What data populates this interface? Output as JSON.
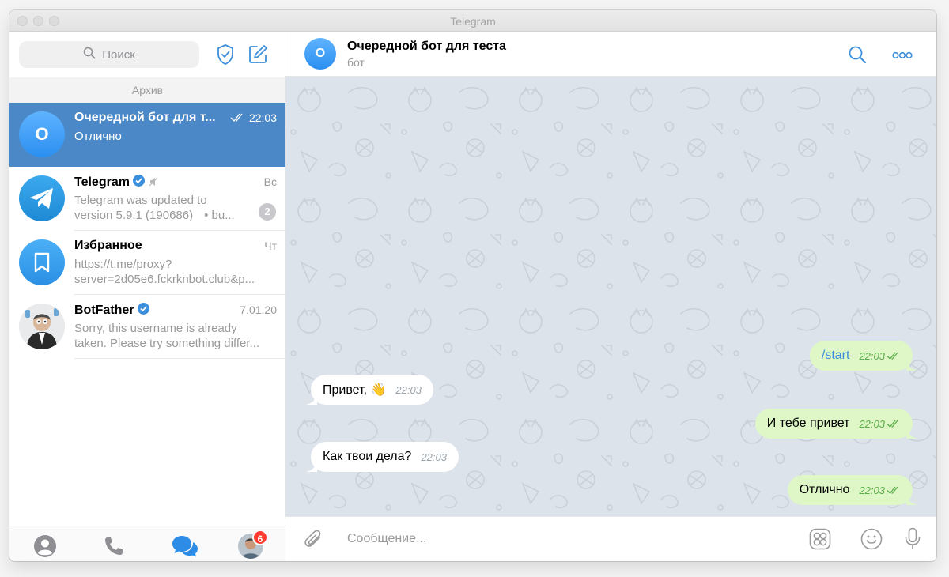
{
  "window": {
    "title": "Telegram"
  },
  "sidebar": {
    "search_placeholder": "Поиск",
    "archive_label": "Архив",
    "chats": [
      {
        "initial": "O",
        "name": "Очередной бот для т...",
        "time": "22:03",
        "preview": "Отлично",
        "active": true
      },
      {
        "name": "Telegram",
        "time": "Вс",
        "preview_line1": "Telegram was updated to",
        "preview_line2": "version 5.9.1 (190686)",
        "preview_extra": "•  bu...",
        "unread": "2",
        "verified": true,
        "muted": true
      },
      {
        "name": "Избранное",
        "time": "Чт",
        "preview_line1": "https://t.me/proxy?",
        "preview_line2": "server=2d05e6.fckrknbot.club&p..."
      },
      {
        "name": "BotFather",
        "time": "7.01.20",
        "preview_line1": "Sorry, this username is already",
        "preview_line2": "taken. Please try something differ...",
        "verified": true
      }
    ],
    "bottom_tabs": [
      "contacts-icon",
      "calls-icon",
      "chats-icon",
      "settings-avatar"
    ],
    "settings_badge": "6"
  },
  "chat": {
    "avatar_initial": "O",
    "title": "Очередной бот для теста",
    "subtitle": "бот",
    "messages": [
      {
        "dir": "out",
        "text": "/start",
        "time": "22:03"
      },
      {
        "dir": "in",
        "text": "Привет, 👋",
        "time": "22:03"
      },
      {
        "dir": "out",
        "text": "И тебе привет",
        "time": "22:03"
      },
      {
        "dir": "in",
        "text": "Как твои дела?",
        "time": "22:03"
      },
      {
        "dir": "out",
        "text": "Отлично",
        "time": "22:03"
      }
    ],
    "composer_placeholder": "Сообщение..."
  },
  "colors": {
    "accent": "#4a88c7",
    "link": "#3d8fdc",
    "outgoing": "#dff7c7",
    "background": "#dde3ea"
  }
}
